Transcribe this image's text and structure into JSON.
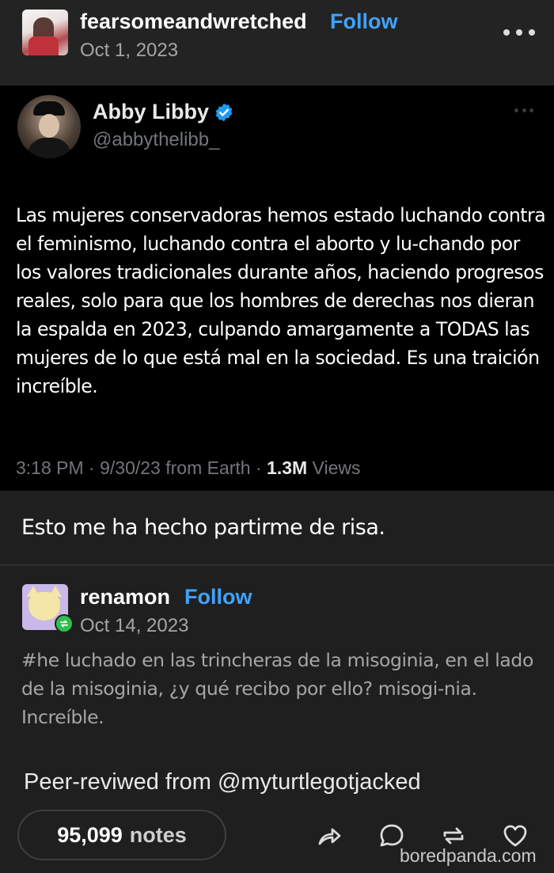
{
  "post": {
    "username": "fearsomeandwretched",
    "follow_label": "Follow",
    "date": "Oct 1, 2023"
  },
  "tweet": {
    "name": "Abby Libby",
    "handle": "@abbythelibb_",
    "text": "Las mujeres conservadoras hemos estado luchando contra el feminismo, luchando contra el aborto y lu-chando por los valores tradicionales durante años, haciendo progresos reales, solo para que los hombres de derechas nos dieran la espalda en 2023, culpando amargamente a TODAS las mujeres de lo que está mal en la sociedad. Es una traición increíble.",
    "meta_time": "3:18 PM · 9/30/23 from Earth · ",
    "meta_views_count": "1.3M",
    "meta_views_label": " Views"
  },
  "caption": "Esto me ha hecho partirme de risa.",
  "reblog": {
    "username": "renamon",
    "follow_label": "Follow",
    "date": "Oct 14, 2023",
    "tags": "#he luchado en las trincheras de la misoginia, en el lado de la misoginia, ¿y qué recibo por ello? misogi-nia. Increíble."
  },
  "peer_reviewed": "Peer-reviwed from @myturtlegotjacked",
  "footer": {
    "notes_count": "95,099",
    "notes_label": "notes"
  },
  "watermark": "boredpanda.com",
  "colors": {
    "background": "#1f1f1f",
    "tweet_background": "#000000",
    "follow_blue": "#3fa3ff",
    "verified_blue": "#1d9bf0",
    "reblog_green": "#2fbf4f"
  },
  "icons": [
    "more-icon",
    "verified-icon",
    "reblog-icon",
    "share-icon",
    "comment-icon",
    "reblog-action-icon",
    "heart-icon"
  ]
}
